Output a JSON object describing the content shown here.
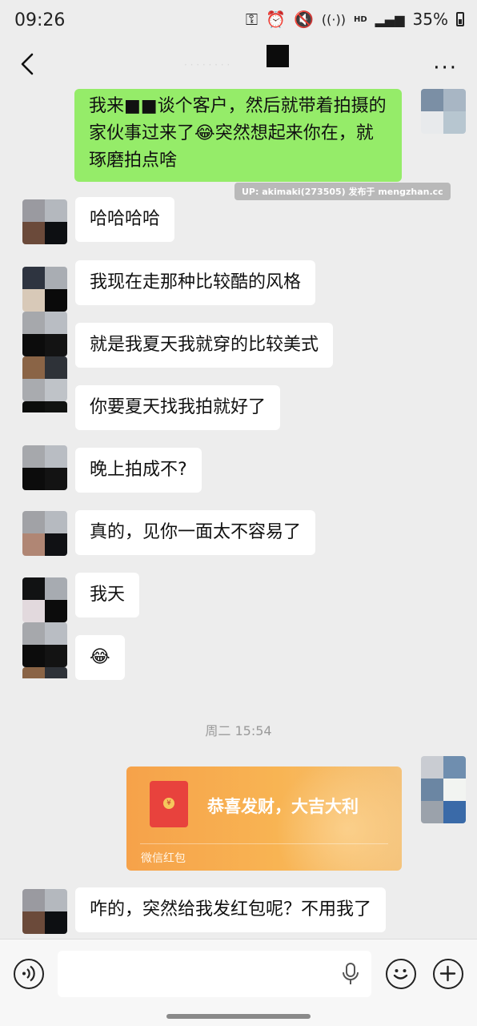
{
  "status": {
    "time": "09:26",
    "network": "HD",
    "battery": "35%"
  },
  "nav": {
    "faint_text": "· · · · · · · ·"
  },
  "messages": [
    {
      "text": "我来■■谈个客户，然后就带着拍摄的家伙事过来了😂突然想起来你在，就琢磨拍点啥"
    },
    {
      "text": "哈哈哈哈"
    },
    {
      "text": "我现在走那种比较酷的风格"
    },
    {
      "text": "就是我夏天我就穿的比较美式"
    },
    {
      "text": "你要夏天找我拍就好了"
    },
    {
      "text": "晚上拍成不?"
    },
    {
      "text": "真的，见你一面太不容易了"
    },
    {
      "text": "我天"
    },
    {
      "text": "😂"
    },
    {
      "text": "咋的，突然给我发红包呢？不用我了"
    }
  ],
  "watermark": "UP: akimaki(273505) 发布于 mengzhan.cc",
  "timestamp": "周二 15:54",
  "red_packet": {
    "title": "恭喜发财，大吉大利",
    "label": "微信红包",
    "coin": "¥"
  },
  "colors": {
    "background": "#ededed",
    "my_bubble": "#95ec69",
    "red_packet": "#f6a24a",
    "envelope": "#e8423d"
  },
  "icons": {
    "back": "chevron-left-icon",
    "more": "more-dots-icon",
    "voice": "voice-icon",
    "mic": "microphone-icon",
    "emoji": "emoji-icon",
    "add": "plus-icon"
  }
}
